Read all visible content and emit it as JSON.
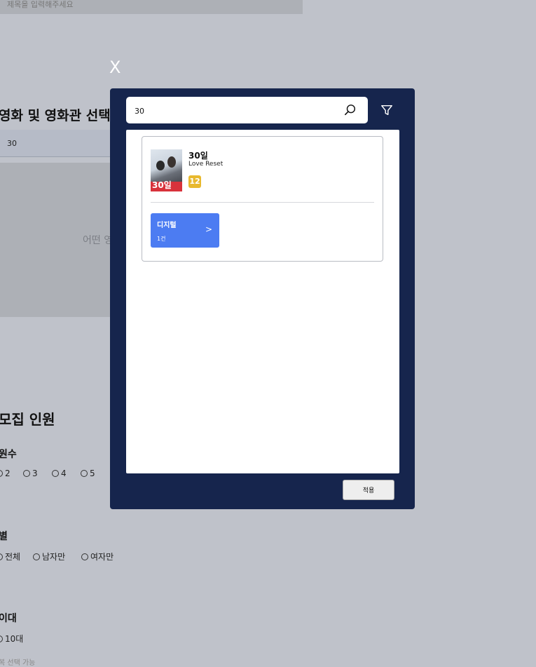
{
  "background": {
    "title_input_placeholder": "제목을 입력해주세요",
    "movie_section_title": "영화 및 영화관 선택",
    "movie_search_value": "30",
    "empty_text": "어떤 영",
    "recruit_title": "모집 인원",
    "headcount_label": "원수",
    "headcount_options": [
      "2",
      "3",
      "4",
      "5"
    ],
    "gender_label": "별",
    "gender_options": [
      "전체",
      "남자만",
      "여자만"
    ],
    "age_label": "이대",
    "age_options": [
      "10대"
    ],
    "age_note": "복 선택 가능"
  },
  "modal": {
    "close_label": "X",
    "search_value": "30",
    "results": [
      {
        "title": "30일",
        "english_title": "Love Reset",
        "rating": "12",
        "poster_text": "30일",
        "formats": [
          {
            "name": "디지털",
            "count": "1건",
            "arrow": ">"
          }
        ]
      }
    ],
    "apply_label": "적용"
  },
  "colors": {
    "modal_bg": "#16254d",
    "format_button": "#4c7cf2",
    "rating_12": "#e8b92e",
    "overlay": "#bfc2ca"
  }
}
